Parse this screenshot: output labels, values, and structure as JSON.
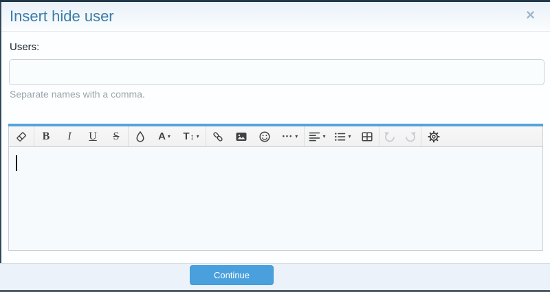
{
  "dialog": {
    "title": "Insert hide user",
    "close_glyph": "×"
  },
  "form": {
    "users_label": "Users:",
    "users_value": "",
    "users_hint": "Separate names with a comma."
  },
  "editor": {
    "glyphs": {
      "bold": "B",
      "italic": "I",
      "underline": "U",
      "strikethrough": "S",
      "font_family": "A",
      "font_size": "T",
      "font_size_arrow": "↕",
      "more": "•••",
      "dropdown_caret": "▾"
    },
    "content": "",
    "icons": {
      "remove_format": "eraser-icon",
      "colors": "droplet-icon",
      "insert_link": "chain-link-icon",
      "insert_image": "picture-icon",
      "emoticons": "smiley-icon",
      "text_align": "align-left-icon",
      "list": "bulleted-list-icon",
      "insert_table": "table-grid-icon",
      "undo": "undo-arrow-icon",
      "redo": "redo-arrow-icon",
      "settings": "gear-icon"
    }
  },
  "footer": {
    "continue_label": "Continue"
  },
  "colors": {
    "top_edge": "#22384a",
    "title_blue": "#3a7ca9",
    "editor_accent": "#55a3d9",
    "button_blue": "#4aa0dd",
    "editor_body_bg": "#f7fafd",
    "footer_bg": "#ecf2f9"
  }
}
